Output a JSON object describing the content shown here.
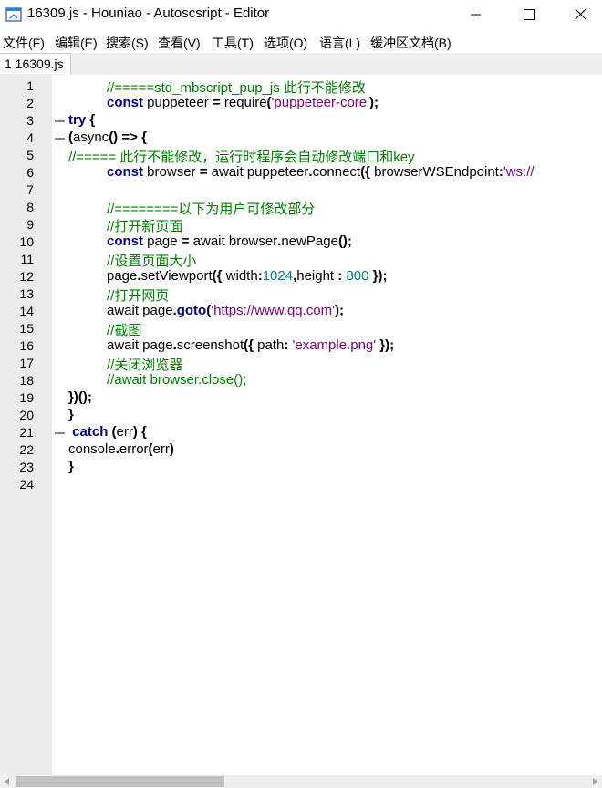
{
  "window": {
    "title": "16309.js - Houniao - Autoscsript - Editor",
    "icon": "editor-app-icon",
    "controls": [
      "minimize-icon",
      "maximize-icon",
      "close-icon"
    ]
  },
  "menu": [
    "文件(F)",
    "编辑(E)",
    "搜索(S)",
    "查看(V)",
    "工具(T)",
    "选项(O)",
    "语言(L)",
    "缓冲区文档(B)"
  ],
  "tabs": [
    {
      "label": "1 16309.js",
      "active": true
    }
  ],
  "editor": {
    "line_numbers": [
      "1",
      "2",
      "3",
      "4",
      "5",
      "6",
      "7",
      "8",
      "9",
      "10",
      "11",
      "12",
      "13",
      "14",
      "15",
      "16",
      "17",
      "18",
      "19",
      "20",
      "21",
      "22",
      "23",
      "24"
    ],
    "lines": [
      {
        "t": [
          {
            "k": "cmt",
            "v": "//=====std_mbscript_pup_js 此行不能修改"
          }
        ]
      },
      {
        "t": [
          {
            "k": "kw",
            "v": "const"
          },
          {
            "k": "",
            "v": " puppeteer "
          },
          {
            "k": "op",
            "v": "="
          },
          {
            "k": "",
            "v": " require"
          },
          {
            "k": "op",
            "v": "("
          },
          {
            "k": "str",
            "v": "'puppeteer-core'"
          },
          {
            "k": "op",
            "v": ");"
          }
        ]
      },
      {
        "t": [
          {
            "k": "kw",
            "v": "try"
          },
          {
            "k": "",
            "v": " "
          },
          {
            "k": "op",
            "v": "{"
          }
        ]
      },
      {
        "t": [
          {
            "k": "op",
            "v": "("
          },
          {
            "k": "",
            "v": "async"
          },
          {
            "k": "op",
            "v": "()"
          },
          {
            "k": "",
            "v": " "
          },
          {
            "k": "op",
            "v": "=>"
          },
          {
            "k": "",
            "v": " "
          },
          {
            "k": "op",
            "v": "{"
          }
        ]
      },
      {
        "t": [
          {
            "k": "cmt",
            "v": "//===== 此行不能修改，运行时程序会自动修改端口和key"
          }
        ]
      },
      {
        "t": [
          {
            "k": "kw",
            "v": "const"
          },
          {
            "k": "",
            "v": " browser "
          },
          {
            "k": "op",
            "v": "="
          },
          {
            "k": "",
            "v": " await puppeteer"
          },
          {
            "k": "op",
            "v": "."
          },
          {
            "k": "",
            "v": "connect"
          },
          {
            "k": "op",
            "v": "({"
          },
          {
            "k": "",
            "v": " browserWSEndpoint"
          },
          {
            "k": "op",
            "v": ":"
          },
          {
            "k": "str",
            "v": "'ws://"
          }
        ]
      },
      {
        "t": []
      },
      {
        "t": [
          {
            "k": "cmt",
            "v": "//========以下为用户可修改部分"
          }
        ]
      },
      {
        "t": [
          {
            "k": "cmt",
            "v": "//打开新页面"
          }
        ]
      },
      {
        "t": [
          {
            "k": "kw",
            "v": "const"
          },
          {
            "k": "",
            "v": " page "
          },
          {
            "k": "op",
            "v": "="
          },
          {
            "k": "",
            "v": " await browser"
          },
          {
            "k": "op",
            "v": "."
          },
          {
            "k": "",
            "v": "newPage"
          },
          {
            "k": "op",
            "v": "();"
          }
        ]
      },
      {
        "t": [
          {
            "k": "cmt",
            "v": "//设置页面大小"
          }
        ]
      },
      {
        "t": [
          {
            "k": "",
            "v": "page"
          },
          {
            "k": "op",
            "v": "."
          },
          {
            "k": "",
            "v": "setViewport"
          },
          {
            "k": "op",
            "v": "({"
          },
          {
            "k": "",
            "v": " width"
          },
          {
            "k": "op",
            "v": ":"
          },
          {
            "k": "num",
            "v": "1024"
          },
          {
            "k": "op",
            "v": ","
          },
          {
            "k": "",
            "v": "height "
          },
          {
            "k": "op",
            "v": ":"
          },
          {
            "k": "",
            "v": " "
          },
          {
            "k": "num",
            "v": "800"
          },
          {
            "k": "",
            "v": " "
          },
          {
            "k": "op",
            "v": "});"
          }
        ]
      },
      {
        "t": [
          {
            "k": "cmt",
            "v": "//打开网页"
          }
        ]
      },
      {
        "t": [
          {
            "k": "",
            "v": "await page"
          },
          {
            "k": "op",
            "v": "."
          },
          {
            "k": "kw",
            "v": "goto"
          },
          {
            "k": "op",
            "v": "("
          },
          {
            "k": "str",
            "v": "'https://www.qq.com'"
          },
          {
            "k": "op",
            "v": ");"
          }
        ]
      },
      {
        "t": [
          {
            "k": "cmt",
            "v": "//截图"
          }
        ]
      },
      {
        "t": [
          {
            "k": "",
            "v": "await page"
          },
          {
            "k": "op",
            "v": "."
          },
          {
            "k": "",
            "v": "screenshot"
          },
          {
            "k": "op",
            "v": "({"
          },
          {
            "k": "",
            "v": " path"
          },
          {
            "k": "op",
            "v": ":"
          },
          {
            "k": "",
            "v": " "
          },
          {
            "k": "str",
            "v": "'example.png'"
          },
          {
            "k": "",
            "v": " "
          },
          {
            "k": "op",
            "v": "});"
          }
        ]
      },
      {
        "t": [
          {
            "k": "cmt",
            "v": "//关闭浏览器"
          }
        ]
      },
      {
        "t": [
          {
            "k": "cmt",
            "v": "//await browser.close();"
          }
        ]
      },
      {
        "t": [
          {
            "k": "op",
            "v": "})();"
          }
        ]
      },
      {
        "t": [
          {
            "k": "op",
            "v": "}"
          }
        ]
      },
      {
        "t": [
          {
            "k": "",
            "v": " "
          },
          {
            "k": "kw",
            "v": "catch"
          },
          {
            "k": "",
            "v": " "
          },
          {
            "k": "op",
            "v": "("
          },
          {
            "k": "",
            "v": "err"
          },
          {
            "k": "op",
            "v": ")"
          },
          {
            "k": "",
            "v": " "
          },
          {
            "k": "op",
            "v": "{"
          }
        ]
      },
      {
        "t": [
          {
            "k": "",
            "v": "console"
          },
          {
            "k": "op",
            "v": "."
          },
          {
            "k": "",
            "v": "error"
          },
          {
            "k": "op",
            "v": "("
          },
          {
            "k": "",
            "v": "err"
          },
          {
            "k": "op",
            "v": ")"
          }
        ]
      },
      {
        "t": [
          {
            "k": "op",
            "v": "}"
          }
        ]
      },
      {
        "t": []
      }
    ],
    "fold_markers": {
      "3": "fold-line-icon",
      "4": "fold-line-icon",
      "21": "fold-line-icon"
    }
  },
  "colors": {
    "keyword": "#000080",
    "string": "#800080",
    "number": "#008080",
    "comment": "#008000",
    "gutter": "#ececec"
  }
}
